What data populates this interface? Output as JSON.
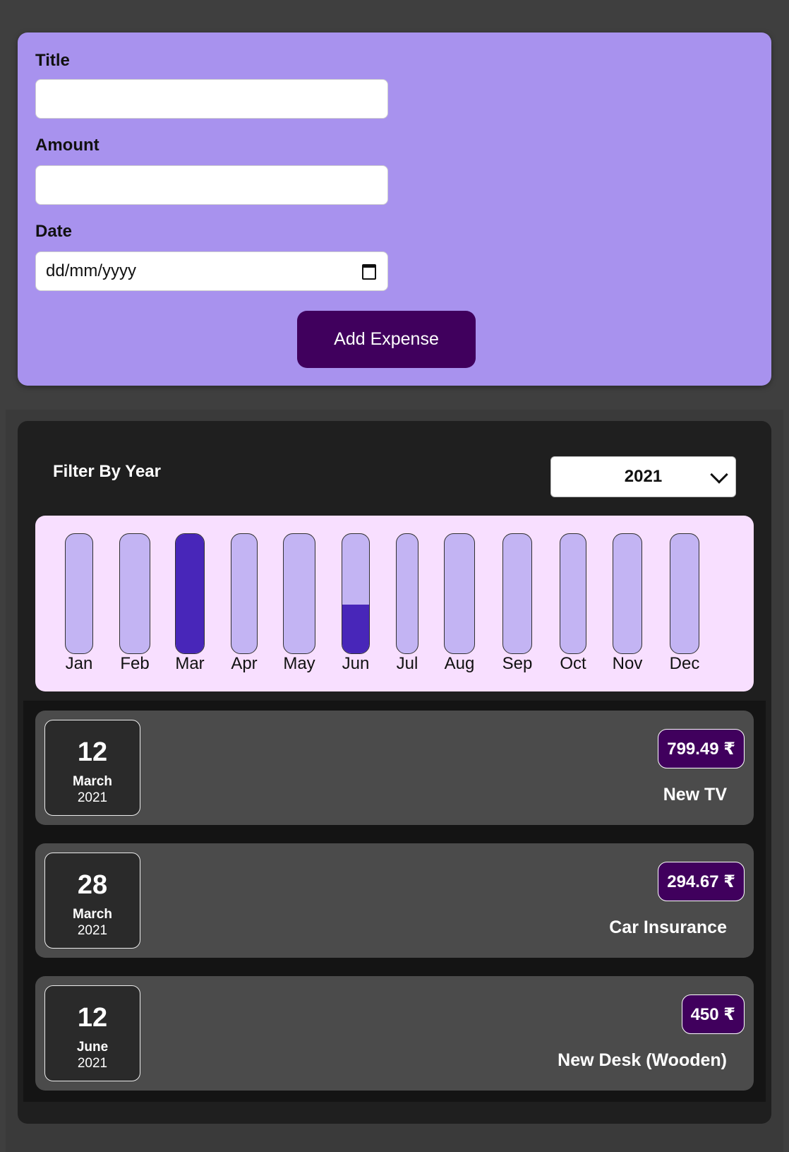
{
  "form": {
    "title_label": "Title",
    "title_value": "",
    "amount_label": "Amount",
    "amount_value": "",
    "date_label": "Date",
    "date_placeholder": "dd/mm/yyyy",
    "submit_label": "Add Expense"
  },
  "filter": {
    "label": "Filter By Year",
    "selected_year": "2021"
  },
  "chart_data": {
    "type": "bar",
    "categories": [
      "Jan",
      "Feb",
      "Mar",
      "Apr",
      "May",
      "Jun",
      "Jul",
      "Aug",
      "Sep",
      "Oct",
      "Nov",
      "Dec"
    ],
    "values": [
      0,
      0,
      1094.16,
      0,
      0,
      450,
      0,
      0,
      0,
      0,
      0,
      0
    ],
    "ylim": [
      0,
      1094.16
    ]
  },
  "expenses": [
    {
      "day": "12",
      "month": "March",
      "year": "2021",
      "amount": "799.49 ₹",
      "title": "New TV"
    },
    {
      "day": "28",
      "month": "March",
      "year": "2021",
      "amount": "294.67 ₹",
      "title": "Car Insurance"
    },
    {
      "day": "12",
      "month": "June",
      "year": "2021",
      "amount": "450 ₹",
      "title": "New Desk (Wooden)"
    }
  ],
  "colors": {
    "form_bg": "#a892ee",
    "accent_dark": "#40005d",
    "bar_fill": "#4826b9",
    "bar_track": "#c3b4f3",
    "chart_bg": "#f8dfff"
  }
}
